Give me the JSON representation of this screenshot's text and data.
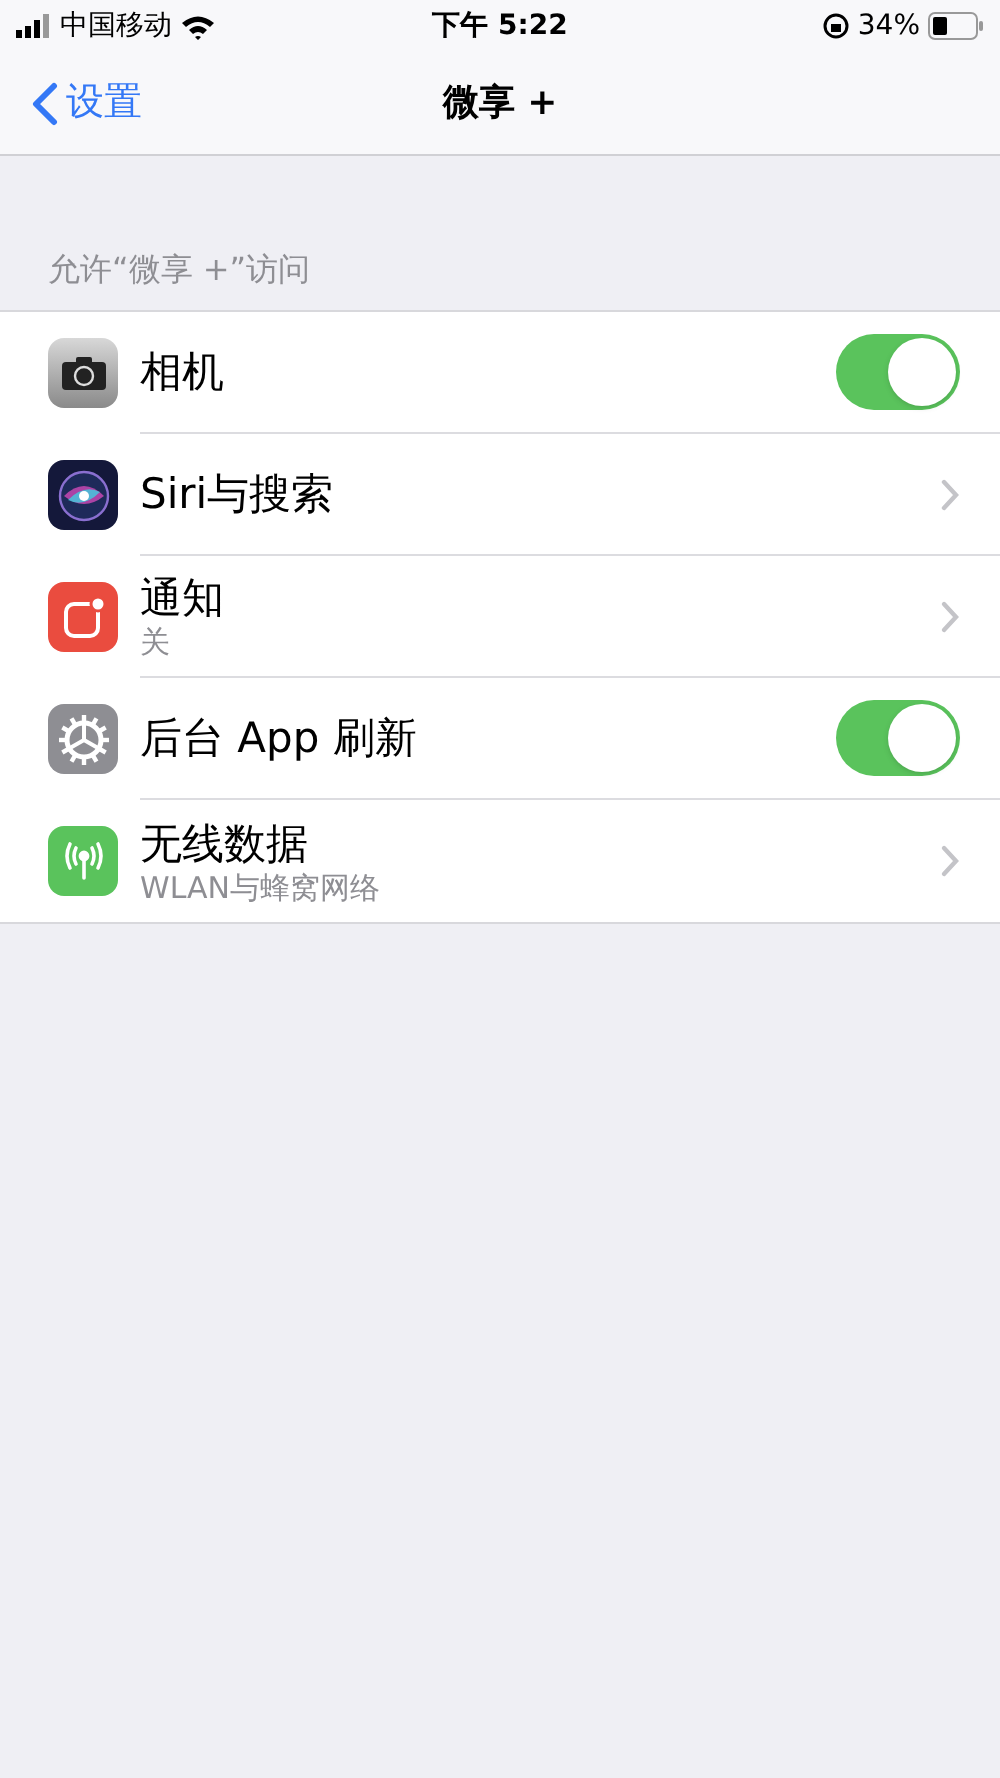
{
  "status_bar": {
    "carrier": "中国移动",
    "time": "下午 5:22",
    "battery": "34%"
  },
  "nav": {
    "back": "设置",
    "title": "微享 +"
  },
  "section": {
    "header": "允许“微享 +”访问",
    "rows": [
      {
        "kind": "toggle",
        "label": "相机",
        "on": true
      },
      {
        "kind": "link",
        "label": "Siri与搜索"
      },
      {
        "kind": "link",
        "label": "通知",
        "detail": "关"
      },
      {
        "kind": "toggle",
        "label": "后台 App 刷新",
        "on": true
      },
      {
        "kind": "link",
        "label": "无线数据",
        "detail": "WLAN与蜂窝网络"
      }
    ]
  }
}
